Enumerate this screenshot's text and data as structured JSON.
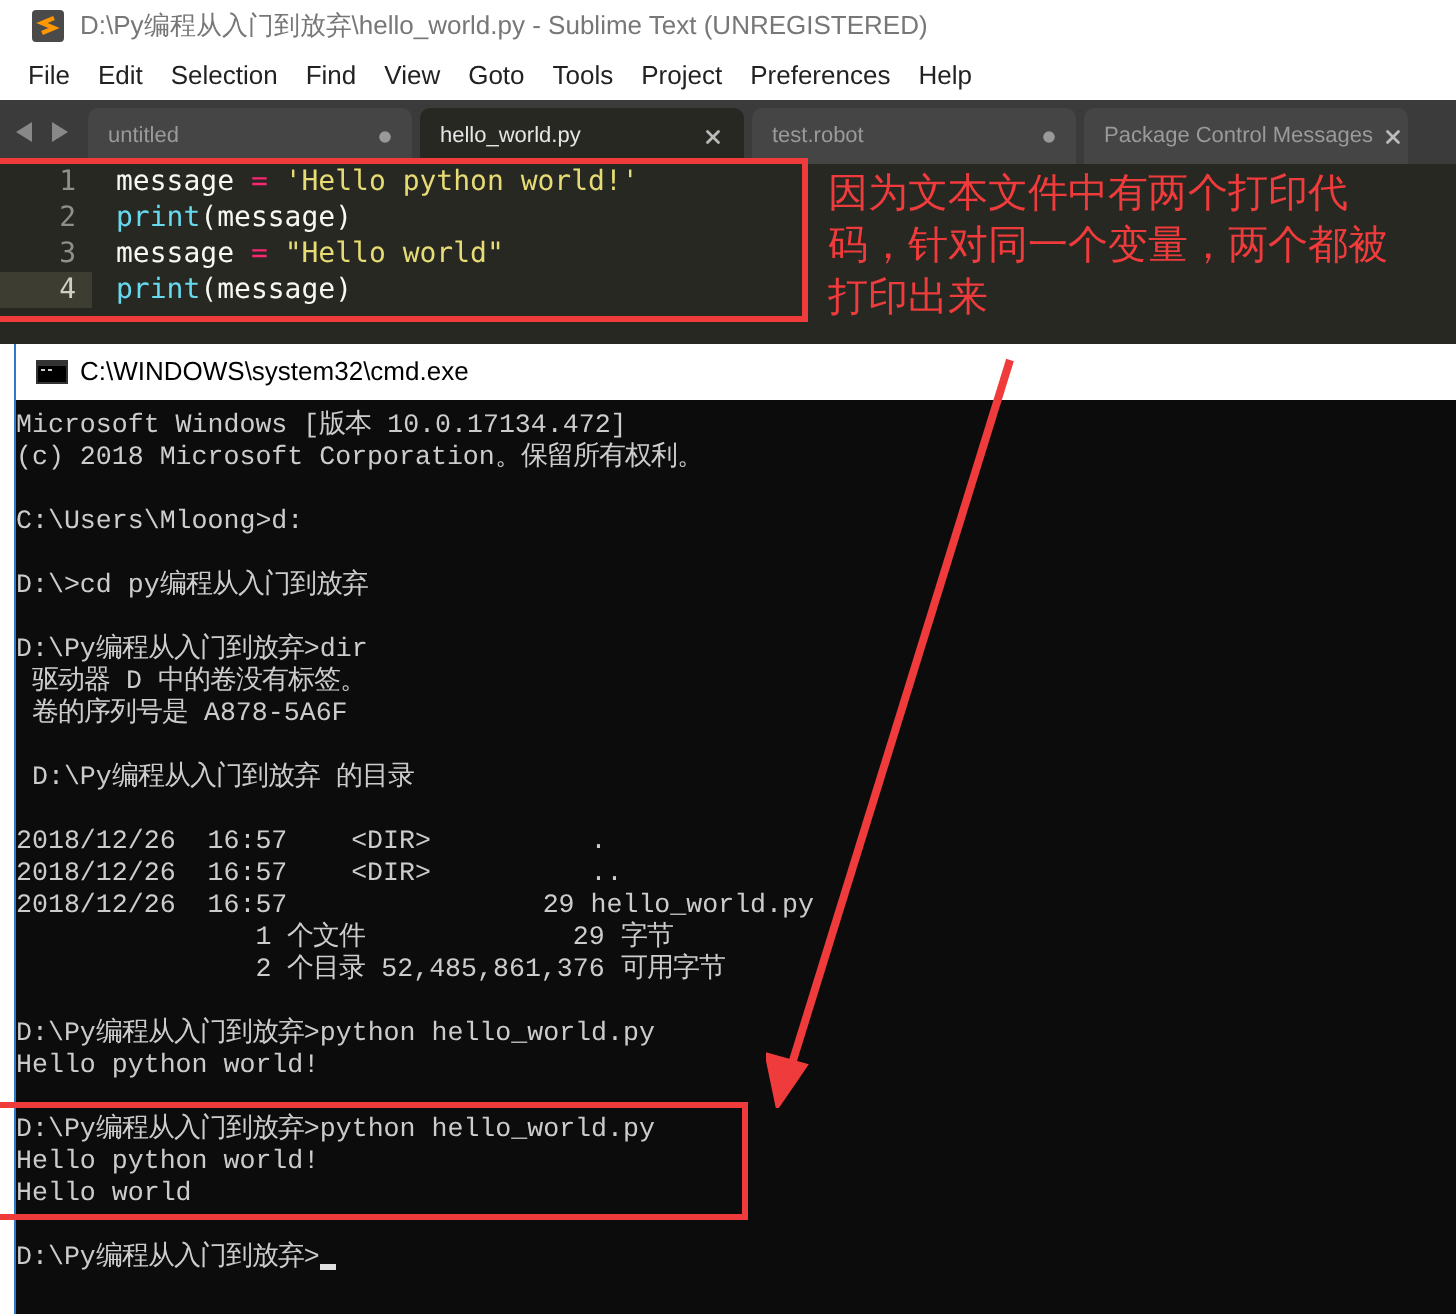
{
  "editor": {
    "title": "D:\\Py编程从入门到放弃\\hello_world.py - Sublime Text (UNREGISTERED)",
    "menu": [
      "File",
      "Edit",
      "Selection",
      "Find",
      "View",
      "Goto",
      "Tools",
      "Project",
      "Preferences",
      "Help"
    ],
    "tabs": [
      {
        "label": "untitled",
        "selected": false,
        "modified": true
      },
      {
        "label": "hello_world.py",
        "selected": true,
        "modified": false
      },
      {
        "label": "test.robot",
        "selected": false,
        "modified": true
      },
      {
        "label": "Package Control Messages",
        "selected": false,
        "modified": false
      }
    ],
    "lines": [
      {
        "number": "1",
        "current": false,
        "tokens": [
          {
            "text": "message",
            "kind": "name"
          },
          {
            "text": " = ",
            "kind": "op"
          },
          {
            "text": "'Hello python world!'",
            "kind": "string"
          }
        ]
      },
      {
        "number": "2",
        "current": false,
        "tokens": [
          {
            "text": "print",
            "kind": "func"
          },
          {
            "text": "(message)",
            "kind": "name"
          }
        ]
      },
      {
        "number": "3",
        "current": false,
        "tokens": [
          {
            "text": "message",
            "kind": "name"
          },
          {
            "text": " = ",
            "kind": "op"
          },
          {
            "text": "\"Hello world\"",
            "kind": "string"
          }
        ]
      },
      {
        "number": "4",
        "current": true,
        "tokens": [
          {
            "text": "print",
            "kind": "func"
          },
          {
            "text": "(message)",
            "kind": "name"
          }
        ]
      }
    ],
    "highlighted": true,
    "annotation": [
      "因为文本文件中有两个打印代",
      "码，针对同一个变量，两个都被",
      "打印出来"
    ]
  },
  "console": {
    "title": "C:\\WINDOWS\\system32\\cmd.exe",
    "blocks": [
      {
        "highlighted": false,
        "lines": [
          "Microsoft Windows [版本 10.0.17134.472]",
          "(c) 2018 Microsoft Corporation。保留所有权利。"
        ]
      },
      {
        "highlighted": false,
        "lines": [
          "C:\\Users\\Mloong>d:"
        ]
      },
      {
        "highlighted": false,
        "lines": [
          "D:\\>cd py编程从入门到放弃"
        ]
      },
      {
        "highlighted": false,
        "lines": [
          "D:\\Py编程从入门到放弃>dir",
          " 驱动器 D 中的卷没有标签。",
          " 卷的序列号是 A878-5A6F"
        ]
      },
      {
        "highlighted": false,
        "lines": [
          " D:\\Py编程从入门到放弃 的目录"
        ]
      },
      {
        "highlighted": false,
        "lines": [
          "2018/12/26  16:57    <DIR>          .",
          "2018/12/26  16:57    <DIR>          ..",
          "2018/12/26  16:57                29 hello_world.py",
          "               1 个文件             29 字节",
          "               2 个目录 52,485,861,376 可用字节"
        ]
      },
      {
        "highlighted": false,
        "lines": [
          "D:\\Py编程从入门到放弃>python hello_world.py",
          "Hello python world!"
        ]
      },
      {
        "highlighted": true,
        "lines": [
          "D:\\Py编程从入门到放弃>python hello_world.py",
          "Hello python world!",
          "Hello world"
        ]
      },
      {
        "highlighted": false,
        "cursor": true,
        "lines": [
          "D:\\Py编程从入门到放弃>"
        ]
      }
    ]
  }
}
